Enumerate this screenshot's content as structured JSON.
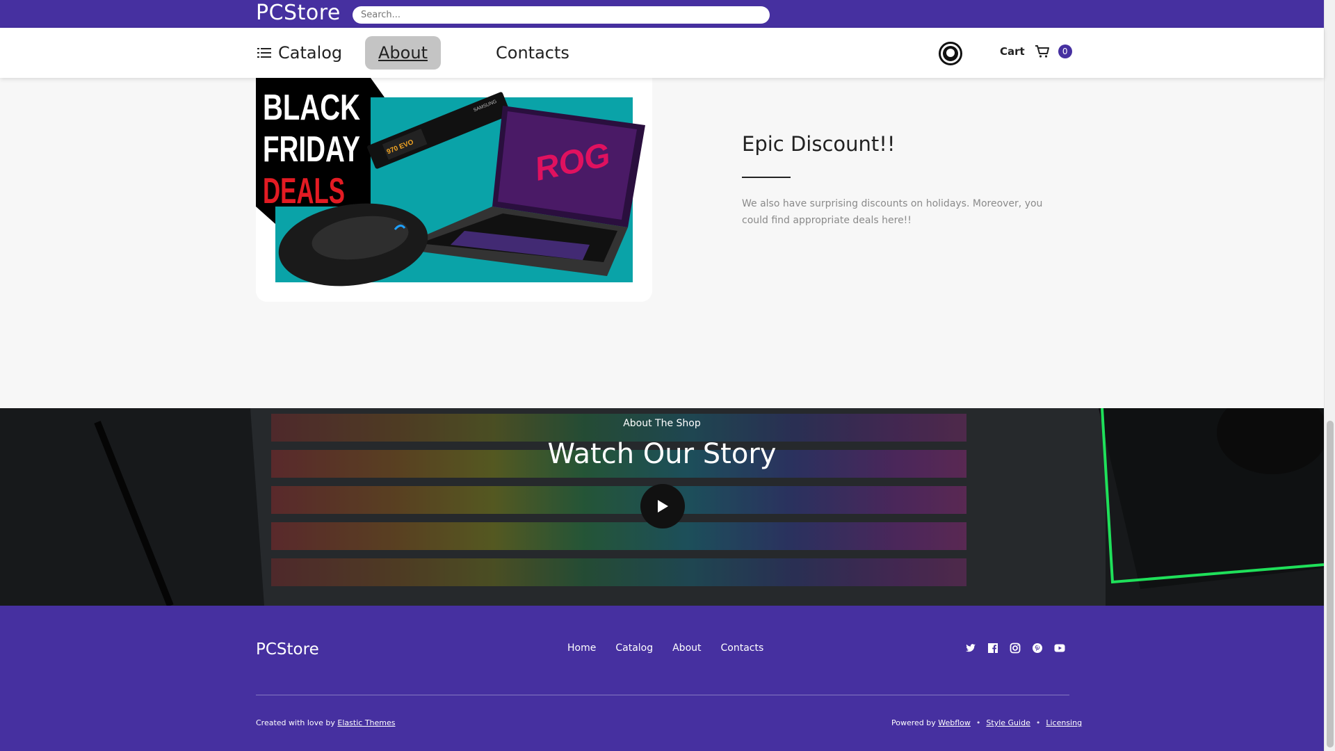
{
  "header": {
    "brand": "PCStore",
    "search_placeholder": "Search..."
  },
  "nav": {
    "catalog": "Catalog",
    "about": "About",
    "contacts": "Contacts",
    "cart_label": "Cart",
    "cart_count": "0"
  },
  "promo": {
    "title": "Epic Discount!!",
    "text": "We also have surprising discounts on holidays. Moreover, you could find appropriate deals here!!",
    "image_text": {
      "line1": "BLACK",
      "line2": "FRIDAY",
      "line3": "DEALS",
      "ssd_brand": "SAMSUNG",
      "ssd_model": "970 EVO",
      "laptop_art": "ROG"
    }
  },
  "story": {
    "eyebrow": "About The Shop",
    "title": "Watch Our Story"
  },
  "footer": {
    "brand": "PCStore",
    "links": [
      "Home",
      "Catalog",
      "About",
      "Contacts"
    ],
    "social_icons": [
      "twitter-icon",
      "facebook-icon",
      "instagram-icon",
      "pinterest-icon",
      "youtube-icon"
    ],
    "created_prefix": "Created with love by",
    "created_link": "Elastic Themes",
    "powered_prefix": "Powered by",
    "powered_link": "Webflow",
    "style_guide": "Style Guide",
    "licensing": "Licensing"
  },
  "colors": {
    "brand_purple": "#4630a0",
    "about_highlight": "#c4c4c4"
  }
}
